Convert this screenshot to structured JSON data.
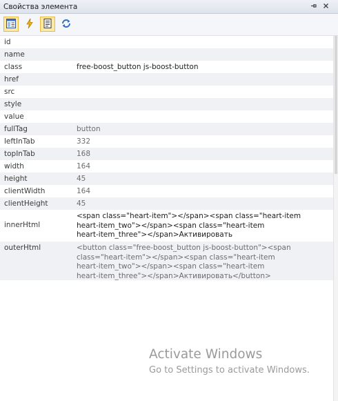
{
  "window": {
    "title": "Свойства элемента",
    "pin_icon": "pin-icon",
    "close_icon": "close-icon"
  },
  "toolbar": {
    "buttons": [
      {
        "icon": "properties-panel-icon",
        "active": true
      },
      {
        "icon": "lightning-icon",
        "active": false
      },
      {
        "icon": "page-icon",
        "active": true
      },
      {
        "icon": "refresh-icon",
        "active": false
      }
    ]
  },
  "properties": [
    {
      "key": "id",
      "value": ""
    },
    {
      "key": "name",
      "value": ""
    },
    {
      "key": "class",
      "value": "free-boost_button js-boost-button"
    },
    {
      "key": "href",
      "value": ""
    },
    {
      "key": "src",
      "value": ""
    },
    {
      "key": "style",
      "value": ""
    },
    {
      "key": "value",
      "value": ""
    },
    {
      "key": "fullTag",
      "value": "button"
    },
    {
      "key": "leftInTab",
      "value": "332"
    },
    {
      "key": "topInTab",
      "value": "168"
    },
    {
      "key": "width",
      "value": "164"
    },
    {
      "key": "height",
      "value": "45"
    },
    {
      "key": "clientWidth",
      "value": "164"
    },
    {
      "key": "clientHeight",
      "value": "45"
    },
    {
      "key": "innerHtml",
      "value": "<span class=\"heart-item\"></span><span class=\"heart-item\nheart-item_two\"></span><span class=\"heart-item\nheart-item_three\"></span>Активировать"
    },
    {
      "key": "outerHtml",
      "value": "<button class=\"free-boost_button js-boost-button\"><span\nclass=\"heart-item\"></span><span class=\"heart-item\nheart-item_two\"></span><span class=\"heart-item\nheart-item_three\"></span>Активировать</button>"
    }
  ],
  "watermark": {
    "line1": "Activate Windows",
    "line2": "Go to Settings to activate Windows."
  }
}
